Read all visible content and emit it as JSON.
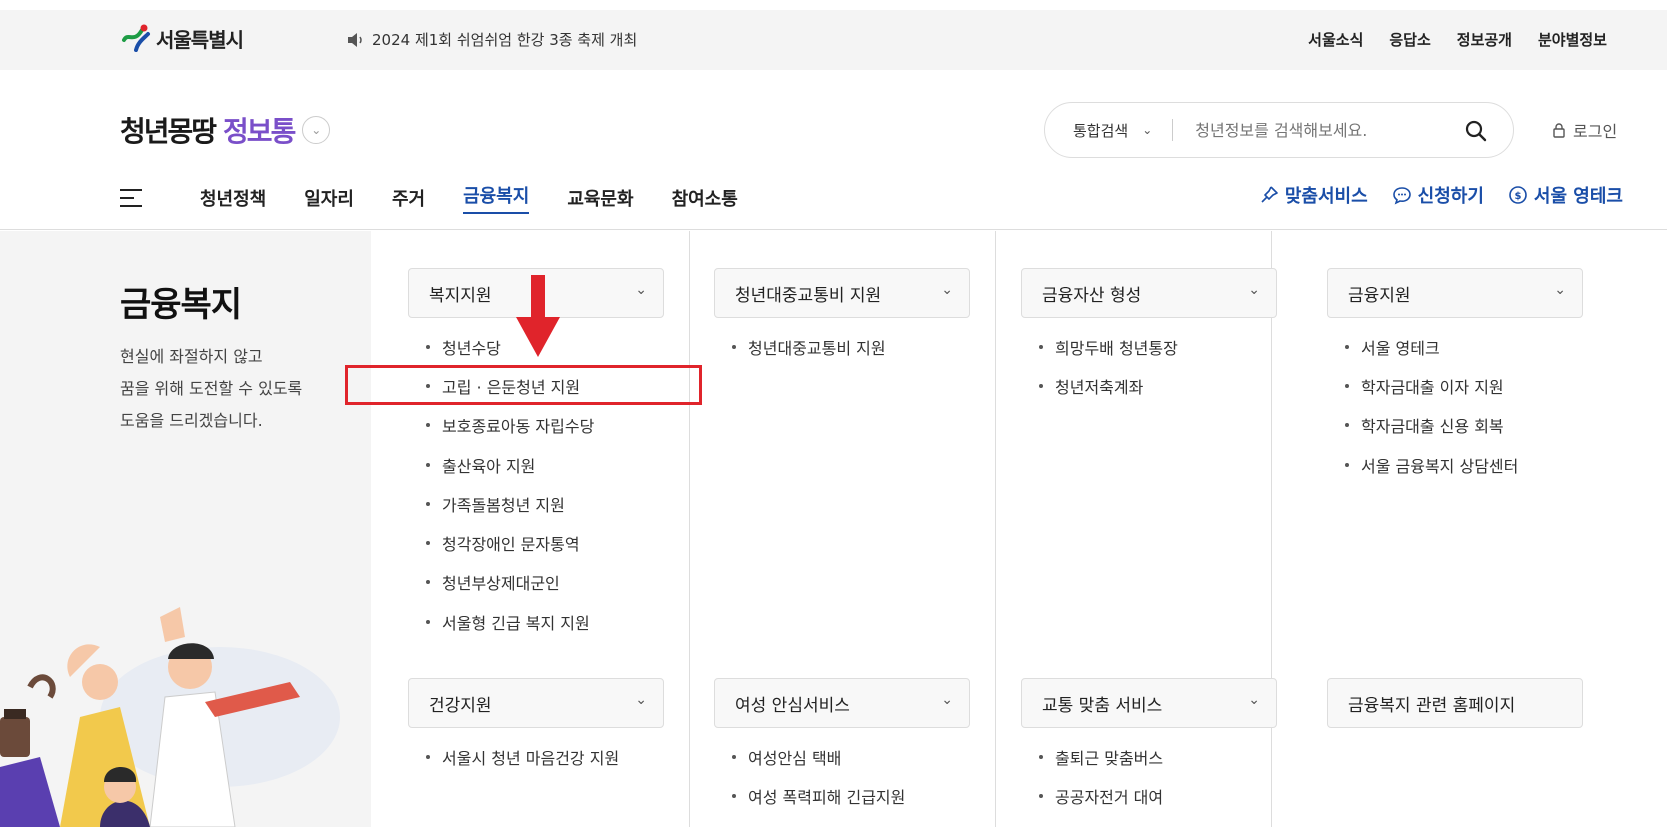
{
  "topbar": {
    "logo_text": "서울특별시",
    "notice": "2024 제1회 쉬엄쉬엄 한강 3종 축제 개최",
    "util_links": [
      "서울소식",
      "응답소",
      "정보공개",
      "분야별정보"
    ]
  },
  "header": {
    "brand_part1": "청년몽땅",
    "brand_part2": "정보통",
    "search_scope": "통합검색",
    "search_placeholder": "청년정보를 검색해보세요.",
    "login": "로그인",
    "gnb": [
      "청년정책",
      "일자리",
      "주거",
      "금융복지",
      "교육문화",
      "참여소통"
    ],
    "active_menu": "금융복지",
    "quick_links": [
      "맞춤서비스",
      "신청하기",
      "서울 영테크"
    ],
    "accent_color": "#1a4ea8"
  },
  "left": {
    "title": "금융복지",
    "desc_lines": [
      "현실에 좌절하지 않고",
      "꿈을 위해 도전할 수 있도록",
      "도움을 드리겠습니다."
    ]
  },
  "columns": [
    {
      "category": "복지지원",
      "items": [
        "청년수당",
        "고립 · 은둔청년 지원",
        "보호종료아동 자립수당",
        "출산육아 지원",
        "가족돌봄청년 지원",
        "청각장애인 문자통역",
        "청년부상제대군인",
        "서울형 긴급 복지 지원"
      ],
      "category2": "건강지원",
      "items2": [
        "서울시 청년 마음건강 지원"
      ]
    },
    {
      "category": "청년대중교통비 지원",
      "items": [
        "청년대중교통비 지원"
      ],
      "category2": "여성 안심서비스",
      "items2": [
        "여성안심 택배",
        "여성 폭력피해 긴급지원"
      ]
    },
    {
      "category": "금융자산 형성",
      "items": [
        "희망두배 청년통장",
        "청년저축계좌"
      ],
      "category2": "교통 맞춤 서비스",
      "items2": [
        "출퇴근 맞춤버스",
        "공공자전거 대여"
      ]
    },
    {
      "category": "금융지원",
      "items": [
        "서울 영테크",
        "학자금대출 이자 지원",
        "학자금대출 신용 회복",
        "서울 금융복지 상담센터"
      ],
      "category2": "금융복지 관련 홈페이지",
      "items2": []
    }
  ],
  "highlight_color": "#e0242b"
}
